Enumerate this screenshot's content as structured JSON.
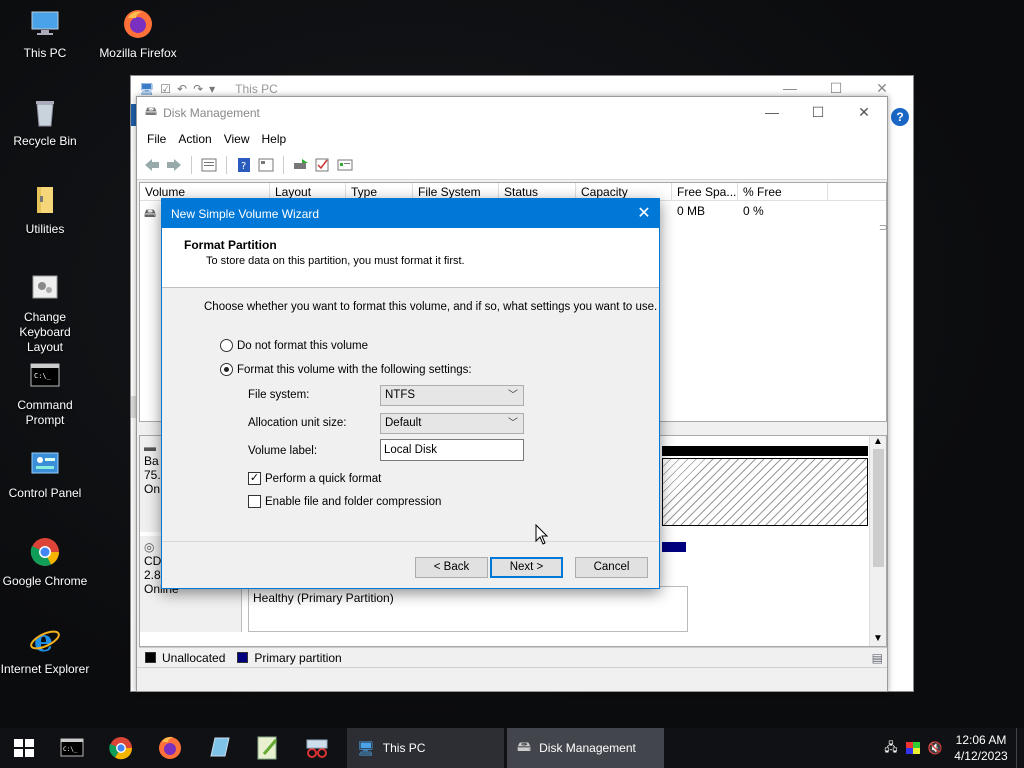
{
  "desktop": {
    "icons": [
      {
        "label": "This PC",
        "icon": "computer-icon"
      },
      {
        "label": "Mozilla Firefox",
        "icon": "firefox-icon"
      },
      {
        "label": "Recycle Bin",
        "icon": "recycle-bin-icon"
      },
      {
        "label": "Utilities",
        "icon": "folder-icon"
      },
      {
        "label": "Change Keyboard Layout",
        "icon": "keyboard-settings-icon"
      },
      {
        "label": "Command Prompt",
        "icon": "cmd-icon"
      },
      {
        "label": "Control Panel",
        "icon": "control-panel-icon"
      },
      {
        "label": "Google Chrome",
        "icon": "chrome-icon"
      },
      {
        "label": "Internet Explorer",
        "icon": "ie-icon"
      }
    ]
  },
  "explorer": {
    "title": "This PC"
  },
  "disk_management": {
    "title": "Disk Management",
    "menu": [
      "File",
      "Action",
      "View",
      "Help"
    ],
    "columns": [
      "Volume",
      "Layout",
      "Type",
      "File System",
      "Status",
      "Capacity",
      "Free Spa...",
      "% Free"
    ],
    "row": {
      "free_space": "0 MB",
      "percent_free": "0 %"
    },
    "disk0": {
      "line1": "Ba",
      "line2": "75.",
      "line3": "On"
    },
    "cdrom": {
      "line1": "CD",
      "line2": "2.8",
      "status": "Online",
      "partition_status": "Healthy (Primary Partition)"
    },
    "legend": {
      "unallocated": "Unallocated",
      "primary": "Primary partition"
    },
    "colors": {
      "unallocated": "#000000",
      "primary": "#00007f"
    }
  },
  "wizard": {
    "title": "New Simple Volume Wizard",
    "heading": "Format Partition",
    "subheading": "To store data on this partition, you must format it first.",
    "instruction": "Choose whether you want to format this volume, and if so, what settings you want to use.",
    "option_no_format": "Do not format this volume",
    "option_format": "Format this volume with the following settings:",
    "file_system_label": "File system:",
    "file_system_value": "NTFS",
    "allocation_label": "Allocation unit size:",
    "allocation_value": "Default",
    "volume_label_label": "Volume label:",
    "volume_label_value": "Local Disk",
    "quick_format_label": "Perform a quick format",
    "quick_format_checked": true,
    "compression_label": "Enable file and folder compression",
    "compression_checked": false,
    "back_button": "< Back",
    "next_button": "Next >",
    "cancel_button": "Cancel"
  },
  "taskbar": {
    "tasks": [
      {
        "label": "This PC"
      },
      {
        "label": "Disk Management"
      }
    ],
    "clock_time": "12:06 AM",
    "clock_date": "4/12/2023"
  }
}
